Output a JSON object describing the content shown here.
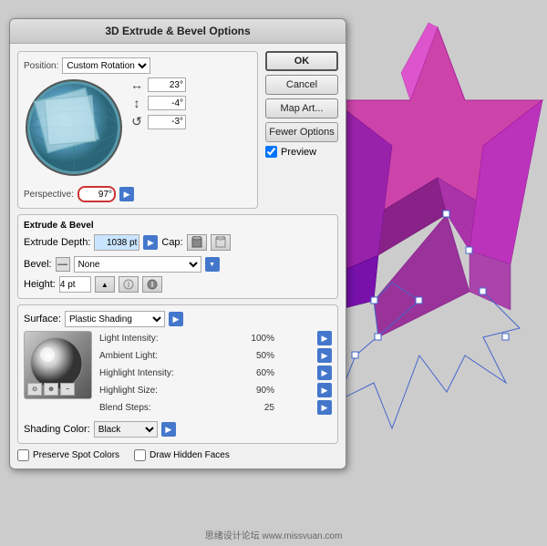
{
  "dialog": {
    "title": "3D Extrude & Bevel Options",
    "position_section": {
      "label": "Position:",
      "dropdown": "Custom Rotation",
      "angle_x": "23°",
      "angle_y": "-4°",
      "angle_z": "-3°",
      "perspective_label": "Perspective:",
      "perspective_value": "97°"
    },
    "buttons": {
      "ok": "OK",
      "cancel": "Cancel",
      "map_art": "Map Art...",
      "fewer_options": "Fewer Options"
    },
    "preview": {
      "label": "Preview",
      "checked": true
    },
    "extrude_bevel": {
      "section_label": "Extrude & Bevel",
      "depth_label": "Extrude Depth:",
      "depth_value": "1038 pt",
      "cap_label": "Cap:",
      "bevel_label": "Bevel:",
      "bevel_value": "None",
      "height_label": "Height:",
      "height_value": "4 pt"
    },
    "surface": {
      "section_label": "Surface:",
      "type": "Plastic Shading",
      "light_intensity_label": "Light Intensity:",
      "light_intensity_value": "100%",
      "ambient_light_label": "Ambient Light:",
      "ambient_light_value": "50%",
      "highlight_intensity_label": "Highlight Intensity:",
      "highlight_intensity_value": "60%",
      "highlight_size_label": "Highlight Size:",
      "highlight_size_value": "90%",
      "blend_steps_label": "Blend Steps:",
      "blend_steps_value": "25",
      "shading_color_label": "Shading Color:",
      "shading_color_value": "Black"
    },
    "checkboxes": {
      "preserve_spot_colors": "Preserve Spot Colors",
      "draw_hidden_faces": "Draw Hidden Faces"
    }
  },
  "watermark": "思绪设计论坛 www.missvuan.com"
}
